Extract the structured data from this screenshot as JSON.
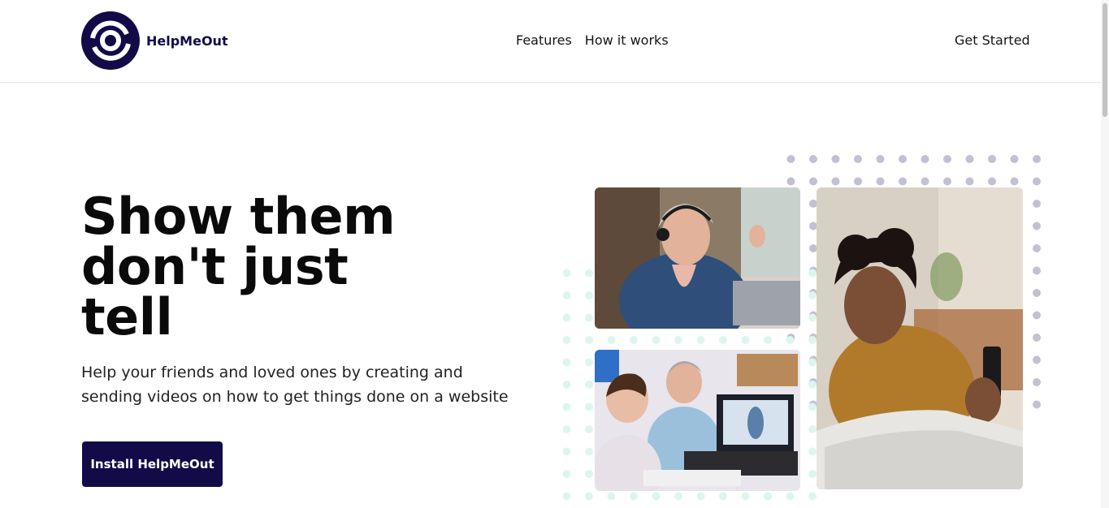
{
  "header": {
    "brand_name": "HelpMeOut",
    "nav": [
      "Features",
      "How it works"
    ],
    "cta": "Get Started"
  },
  "hero": {
    "headline_lines": [
      "Show them",
      "don't just",
      "tell"
    ],
    "subtext": "Help your friends and loved ones by creating and sending videos on how to get things done on a website",
    "button": "Install HelpMeOut"
  },
  "images": [
    {
      "name": "woman-with-headphones-laptop"
    },
    {
      "name": "man-and-boy-at-laptop"
    },
    {
      "name": "woman-smiling-at-phone"
    }
  ],
  "colors": {
    "brand": "#120b48",
    "dot_gray": "#c2c0d2",
    "dot_mint": "#dcf6ee"
  }
}
